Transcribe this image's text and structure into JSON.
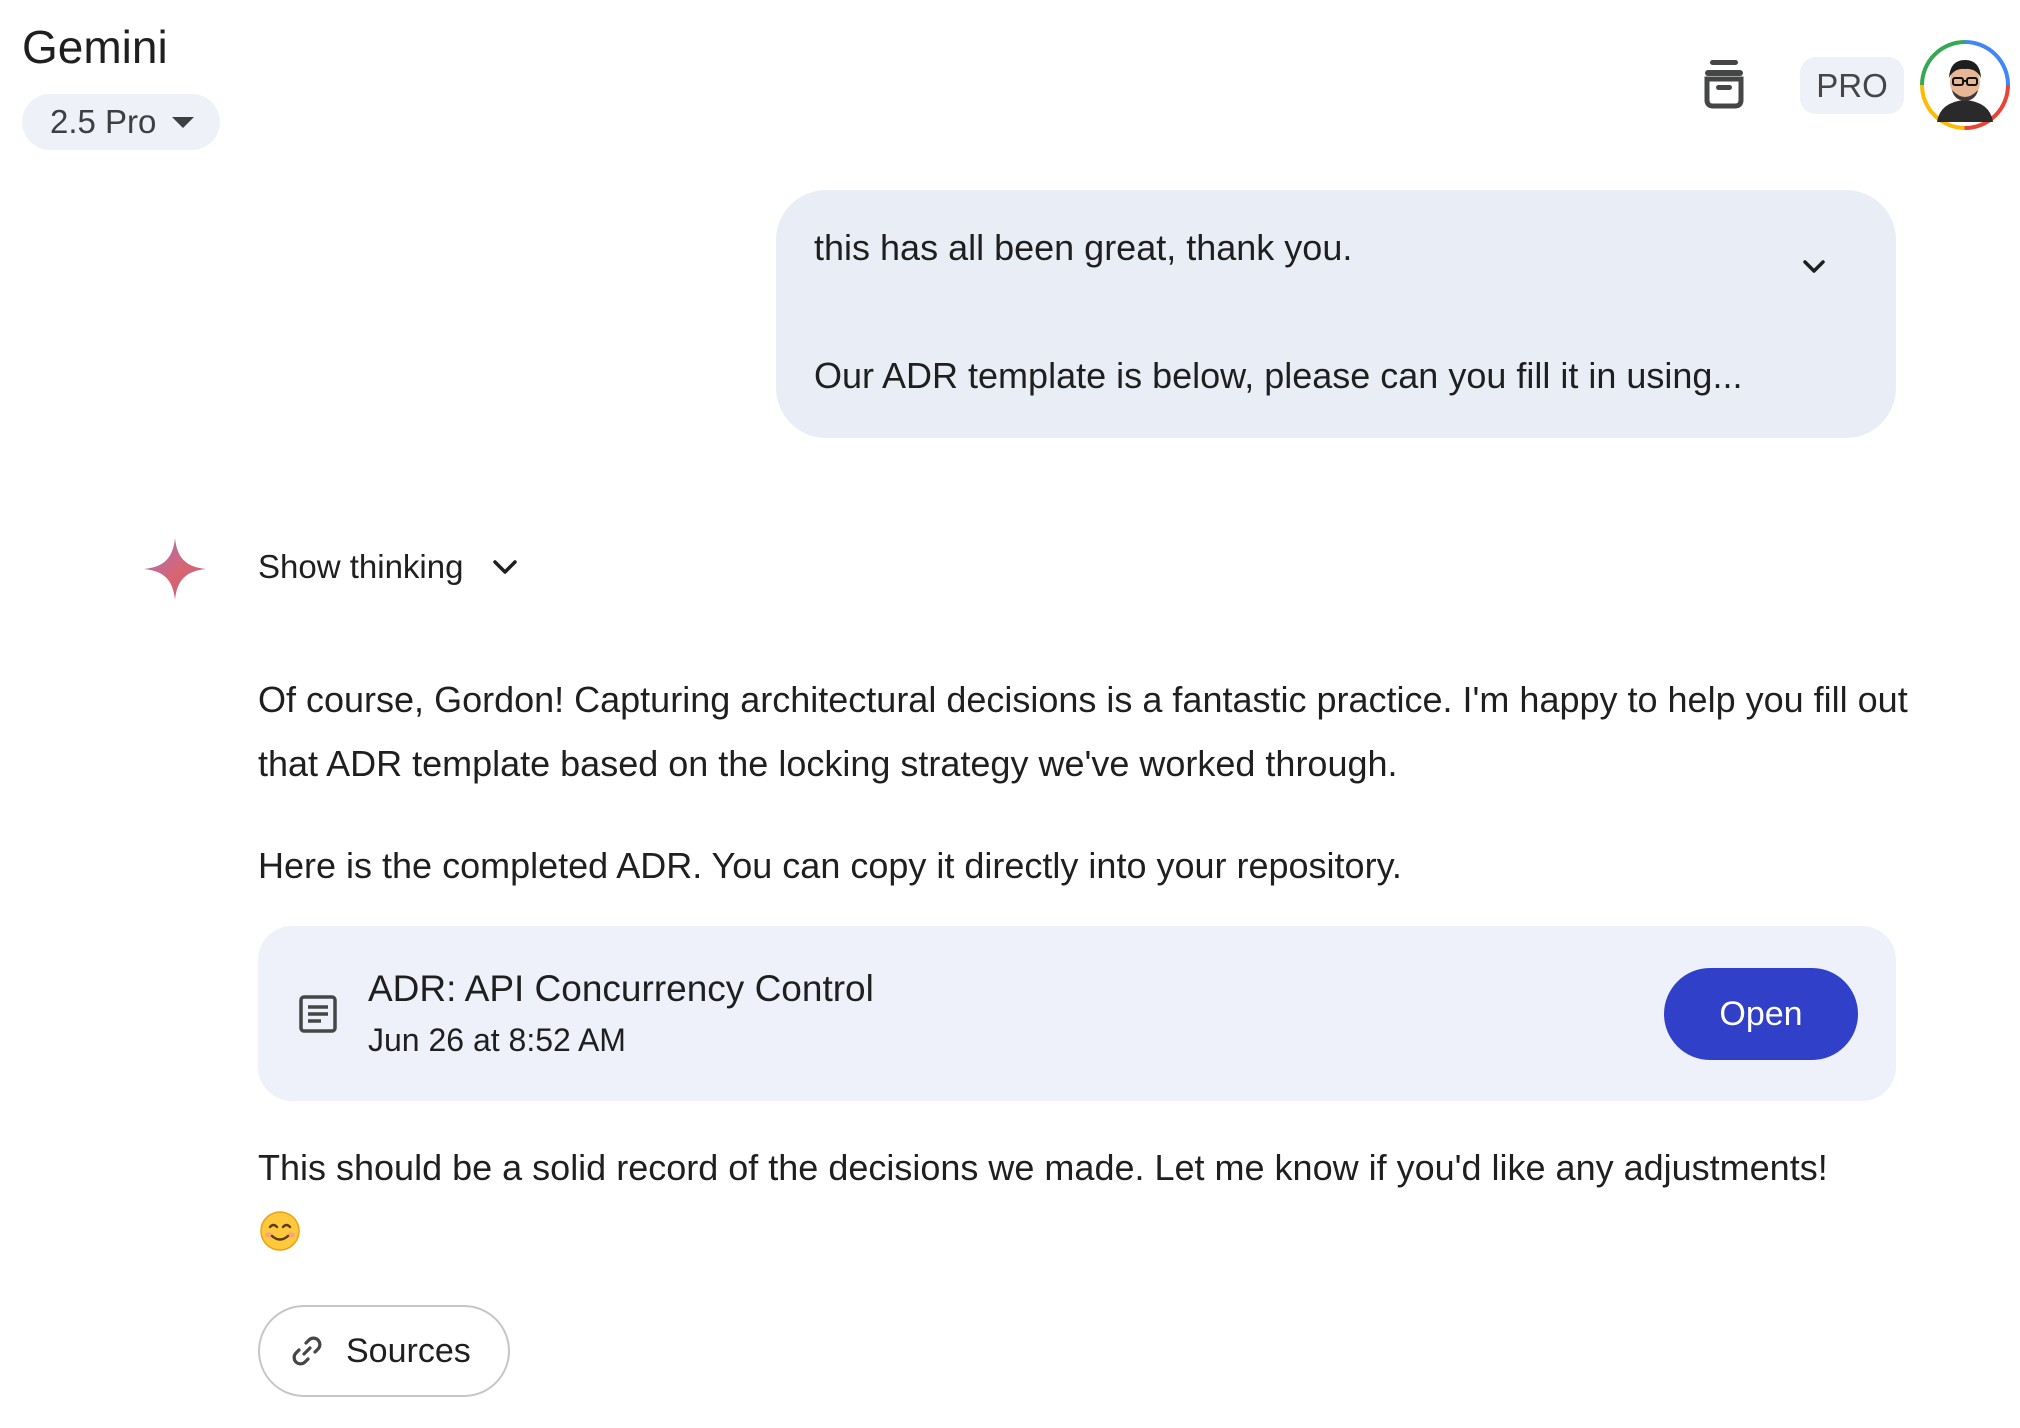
{
  "header": {
    "app_title": "Gemini",
    "model_label": "2.5 Pro",
    "plan_badge": "PRO",
    "icons": [
      "archive-icon",
      "avatar"
    ]
  },
  "user_message": {
    "line1": "this has all been great, thank you.",
    "line2": "Our ADR template is below, please can you fill it in using..."
  },
  "response": {
    "show_thinking_label": "Show thinking",
    "paragraph1": "Of course, Gordon! Capturing architectural decisions is a fantastic practice. I'm happy to help you fill out that ADR template based on the locking strategy we've worked through.",
    "paragraph2": "Here is the completed ADR. You can copy it directly into your repository.",
    "document": {
      "title": "ADR: API Concurrency Control",
      "date": "Jun 26 at 8:52 AM",
      "open_label": "Open"
    },
    "paragraph3": "This should be a solid record of the decisions we made. Let me know if you'd like any adjustments!",
    "emoji": "smiling-face-emoji",
    "sources_label": "Sources"
  },
  "colors": {
    "accent": "#3140c9",
    "bubble": "#e9eef6",
    "card": "#eef1f9"
  }
}
